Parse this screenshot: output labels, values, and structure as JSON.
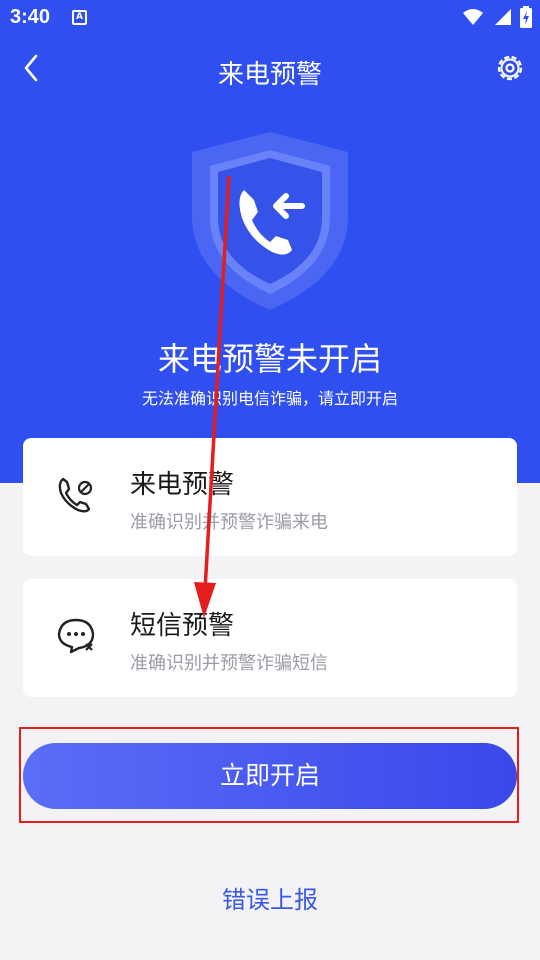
{
  "status_bar": {
    "time": "3:40",
    "notification_glyph": "A",
    "icons": [
      "wifi-icon",
      "signal-icon",
      "battery-icon"
    ]
  },
  "header": {
    "title": "来电预警",
    "back_icon": "chevron-left-icon",
    "settings_icon": "gear-icon"
  },
  "hero": {
    "heading": "来电预警未开启",
    "subheading": "无法准确识别电信诈骗，请立即开启",
    "icon": "shield-incoming-call-icon"
  },
  "cards": [
    {
      "title": "来电预警",
      "description": "准确识别并预警诈骗来电",
      "icon": "phone-block-icon"
    },
    {
      "title": "短信预警",
      "description": "准确识别并预警诈骗短信",
      "icon": "message-block-icon"
    }
  ],
  "actions": {
    "enable_label": "立即开启",
    "report_label": "错误上报"
  },
  "colors": {
    "hero_blue": "#2f4ff0",
    "button_gradient_start": "#5a6ef7",
    "button_gradient_end": "#3848ea",
    "link_blue": "#3a58e6",
    "annotation_red": "#e41d1d"
  }
}
